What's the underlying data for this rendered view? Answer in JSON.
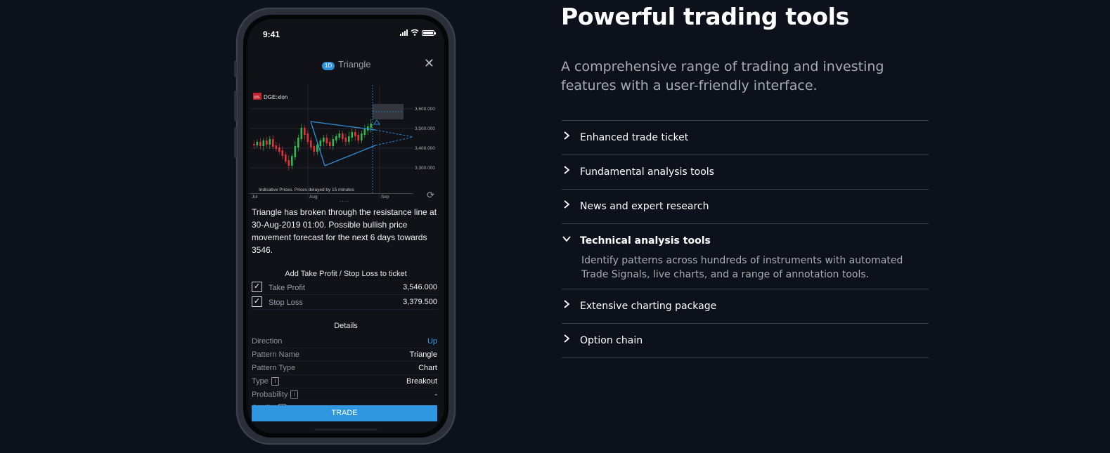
{
  "phone": {
    "status_time": "9:41",
    "modal": {
      "badge": "1D",
      "title": "Triangle",
      "close_symbol": "✕"
    },
    "chart": {
      "symbol": "DGE:xlon",
      "logo_text": "crs",
      "notice": "Indicative Prices. Prices delayed by 15 minutes",
      "y_ticks": [
        "3,600.000",
        "3,500.000",
        "3,400.000",
        "3,300.000"
      ],
      "x_ticks": [
        "Jul",
        "Aug",
        "Sep"
      ],
      "year": "2019"
    },
    "description": "Triangle has broken through the resistance line at 30-Aug-2019 01:00. Possible bullish price movement forecast for the next 6 days towards 3546.",
    "tp_sl_title": "Add Take Profit / Stop Loss to ticket",
    "take_profit": {
      "label": "Take Profit",
      "value": "3,546.000",
      "checked": true
    },
    "stop_loss": {
      "label": "Stop Loss",
      "value": "3,379.500",
      "checked": true
    },
    "details_title": "Details",
    "details": [
      {
        "key": "Direction",
        "value": "Up"
      },
      {
        "key": "Pattern Name",
        "value": "Triangle"
      },
      {
        "key": "Pattern Type",
        "value": "Chart"
      },
      {
        "key": "Type",
        "value": "Breakout"
      },
      {
        "key": "Probability",
        "value": "-"
      },
      {
        "key": "Quality",
        "value": "----"
      }
    ],
    "trade_button": "TRADE"
  },
  "section": {
    "headline": "Powerful trading tools",
    "subtitle": "A comprehensive range of trading and investing features with a user-friendly interface.",
    "accordion": [
      {
        "label": "Enhanced trade ticket",
        "open": false
      },
      {
        "label": "Fundamental analysis tools",
        "open": false
      },
      {
        "label": "News and expert research",
        "open": false
      },
      {
        "label": "Technical analysis tools",
        "open": true,
        "body": "Identify patterns across hundreds of instruments with automated Trade Signals, live charts, and a range of annotation tools."
      },
      {
        "label": "Extensive charting package",
        "open": false
      },
      {
        "label": "Option chain",
        "open": false
      }
    ]
  },
  "colors": {
    "background": "#0d111b",
    "accent_blue": "#2f97e0",
    "candle_up": "#2cb84a",
    "candle_down": "#e0333a"
  }
}
